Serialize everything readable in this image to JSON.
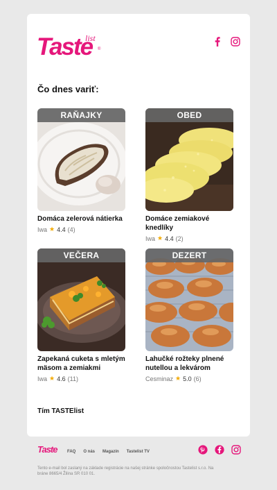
{
  "brand": {
    "logo_text": "Taste",
    "logo_sub": "list",
    "logo_reg": "®",
    "accent": "#e5177b",
    "social": [
      "facebook-icon",
      "instagram-icon"
    ]
  },
  "intro": "Čo dnes variť:",
  "recipes": [
    {
      "category": "RAŇAJKY",
      "title": "Domáca zelerová nátierka",
      "author": "Iwa",
      "rating": "4.4",
      "count": "(4)"
    },
    {
      "category": "OBED",
      "title": "Domáce zemiakové knedlíky",
      "author": "Iwa",
      "rating": "4.4",
      "count": "(2)"
    },
    {
      "category": "VEČERA",
      "title": "Zapekaná cuketa s mletým mäsom a zemiakmi",
      "author": "Iwa",
      "rating": "4.6",
      "count": "(11)"
    },
    {
      "category": "DEZERT",
      "title": "Lahučké rožteky plnené nutellou a lekvárom",
      "author": "Cesminaz",
      "rating": "5.0",
      "count": "(6)"
    }
  ],
  "star_glyph": "★",
  "signoff": "Tím TASTElist",
  "footer": {
    "logo": "Taste",
    "links": [
      "FAQ",
      "O nás",
      "Magazín",
      "Tastelist TV"
    ],
    "social": [
      "pinterest-icon",
      "facebook-icon",
      "instagram-icon"
    ],
    "legal": "Tento e-mail bol zaslaný na základe registrácie na našej stránke spoločnostou Tastelist s.r.o. Na bráne 8665/4 Žilina SR 010 01."
  }
}
